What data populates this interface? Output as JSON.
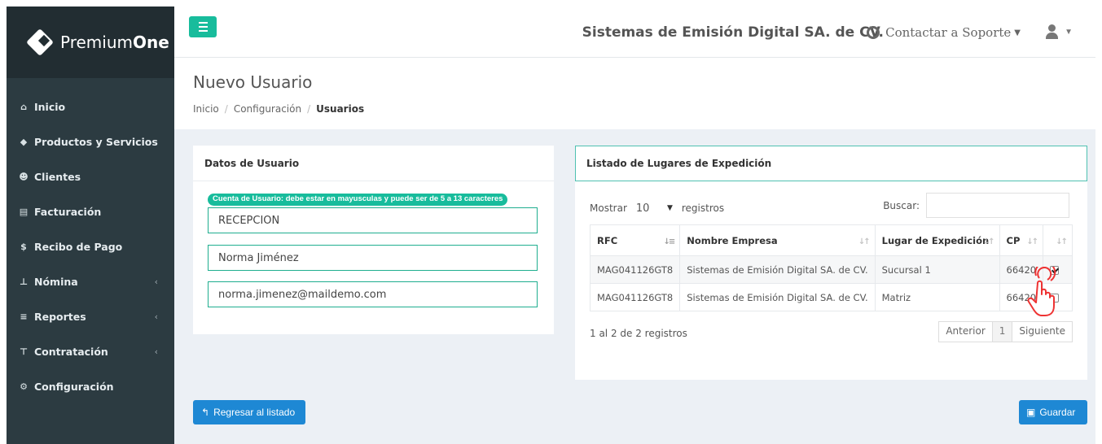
{
  "brand": {
    "name_light": "Premium",
    "name_bold": "One"
  },
  "sidebar": {
    "items": [
      {
        "label": "Inicio",
        "icon": "home-icon",
        "has_caret": false
      },
      {
        "label": "Productos y Servicios",
        "icon": "tag-icon",
        "has_caret": false
      },
      {
        "label": "Clientes",
        "icon": "users-icon",
        "has_caret": false
      },
      {
        "label": "Facturación",
        "icon": "file-icon",
        "has_caret": false
      },
      {
        "label": "Recibo de Pago",
        "icon": "dollar-icon",
        "has_caret": false
      },
      {
        "label": "Nómina",
        "icon": "sitemap-icon",
        "has_caret": true
      },
      {
        "label": "Reportes",
        "icon": "list-icon",
        "has_caret": true
      },
      {
        "label": "Contratación",
        "icon": "cart-icon",
        "has_caret": true
      },
      {
        "label": "Configuración",
        "icon": "cogs-icon",
        "has_caret": false
      }
    ]
  },
  "header": {
    "company": "Sistemas de Emisión Digital SA. de CV.",
    "support_label": "Contactar a Soporte",
    "accent_color": "#18bc9c"
  },
  "page": {
    "title": "Nuevo Usuario",
    "breadcrumb": [
      "Inicio",
      "Configuración",
      "Usuarios"
    ]
  },
  "user_form": {
    "title": "Datos de Usuario",
    "hint": "Cuenta de Usuario: debe estar en mayusculas y puede ser de 5 a 13 caracteres",
    "username": "RECEPCION",
    "full_name": "Norma Jiménez",
    "email": "norma.jimenez@maildemo.com"
  },
  "places": {
    "title": "Listado de Lugares de Expedición",
    "show_label": "Mostrar",
    "page_size": "10",
    "records_label": "registros",
    "search_label": "Buscar:",
    "columns": [
      "RFC",
      "Nombre Empresa",
      "Lugar de Expedición",
      "CP",
      ""
    ],
    "rows": [
      {
        "rfc": "MAG041126GT8",
        "company": "Sistemas de Emisión Digital SA. de CV.",
        "place": "Sucursal 1",
        "cp": "66420",
        "checked": true
      },
      {
        "rfc": "MAG041126GT8",
        "company": "Sistemas de Emisión Digital SA. de CV.",
        "place": "Matriz",
        "cp": "66420",
        "checked": false
      }
    ],
    "info": "1 al 2 de 2 registros",
    "pager": {
      "prev": "Anterior",
      "page": "1",
      "next": "Siguiente"
    }
  },
  "actions": {
    "back_label": "Regresar al listado",
    "save_label": "Guardar",
    "button_color": "#1e88d4"
  }
}
